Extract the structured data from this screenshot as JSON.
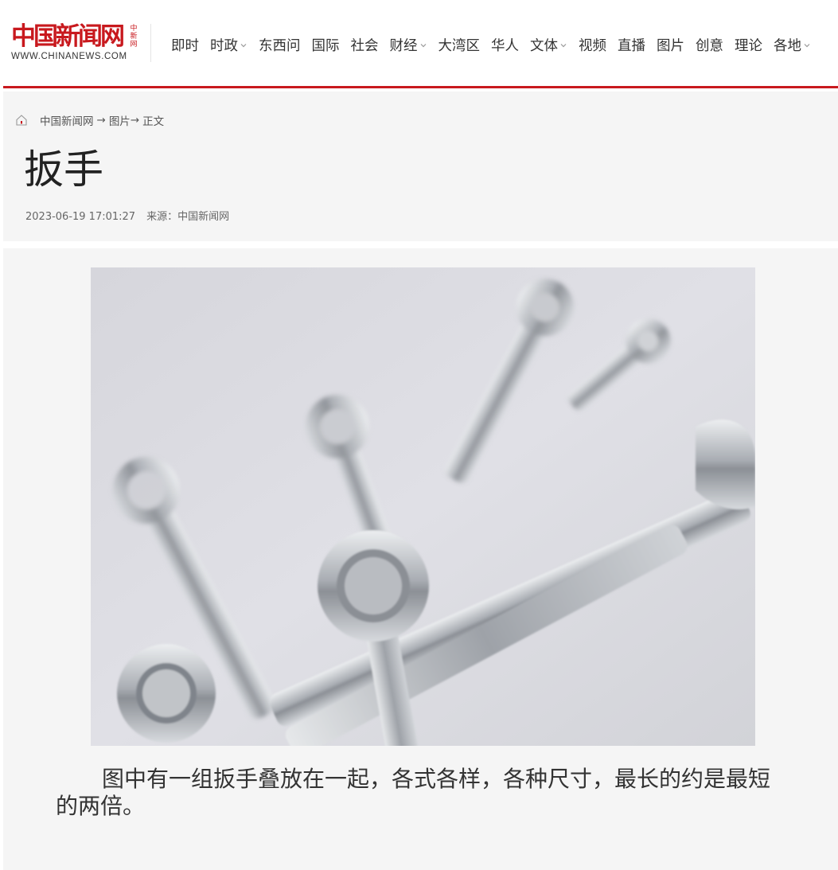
{
  "site": {
    "logo_cn": "中国新闻网",
    "logo_side": "中新网",
    "logo_en": "WWW.CHINANEWS.COM",
    "brand_color": "#c8191e"
  },
  "nav": {
    "items": [
      {
        "label": "即时",
        "dropdown": false
      },
      {
        "label": "时政",
        "dropdown": true
      },
      {
        "label": "东西问",
        "dropdown": false
      },
      {
        "label": "国际",
        "dropdown": false
      },
      {
        "label": "社会",
        "dropdown": false
      },
      {
        "label": "财经",
        "dropdown": true
      },
      {
        "label": "大湾区",
        "dropdown": false
      },
      {
        "label": "华人",
        "dropdown": false
      },
      {
        "label": "文体",
        "dropdown": true
      },
      {
        "label": "视频",
        "dropdown": false
      },
      {
        "label": "直播",
        "dropdown": false
      },
      {
        "label": "图片",
        "dropdown": false
      },
      {
        "label": "创意",
        "dropdown": false
      },
      {
        "label": "理论",
        "dropdown": false
      },
      {
        "label": "各地",
        "dropdown": true
      }
    ]
  },
  "breadcrumb": {
    "home_icon": "home-icon",
    "site": "中国新闻网",
    "arrow1": "→",
    "section": "图片",
    "arrow2": "→",
    "current": "正文"
  },
  "article": {
    "title": "扳手",
    "datetime": "2023-06-19 17:01:27",
    "source": "来源：中国新闻网",
    "caption": "图中有一组扳手叠放在一起，各式各样，各种尺寸，最长的约是最短的两倍。"
  }
}
